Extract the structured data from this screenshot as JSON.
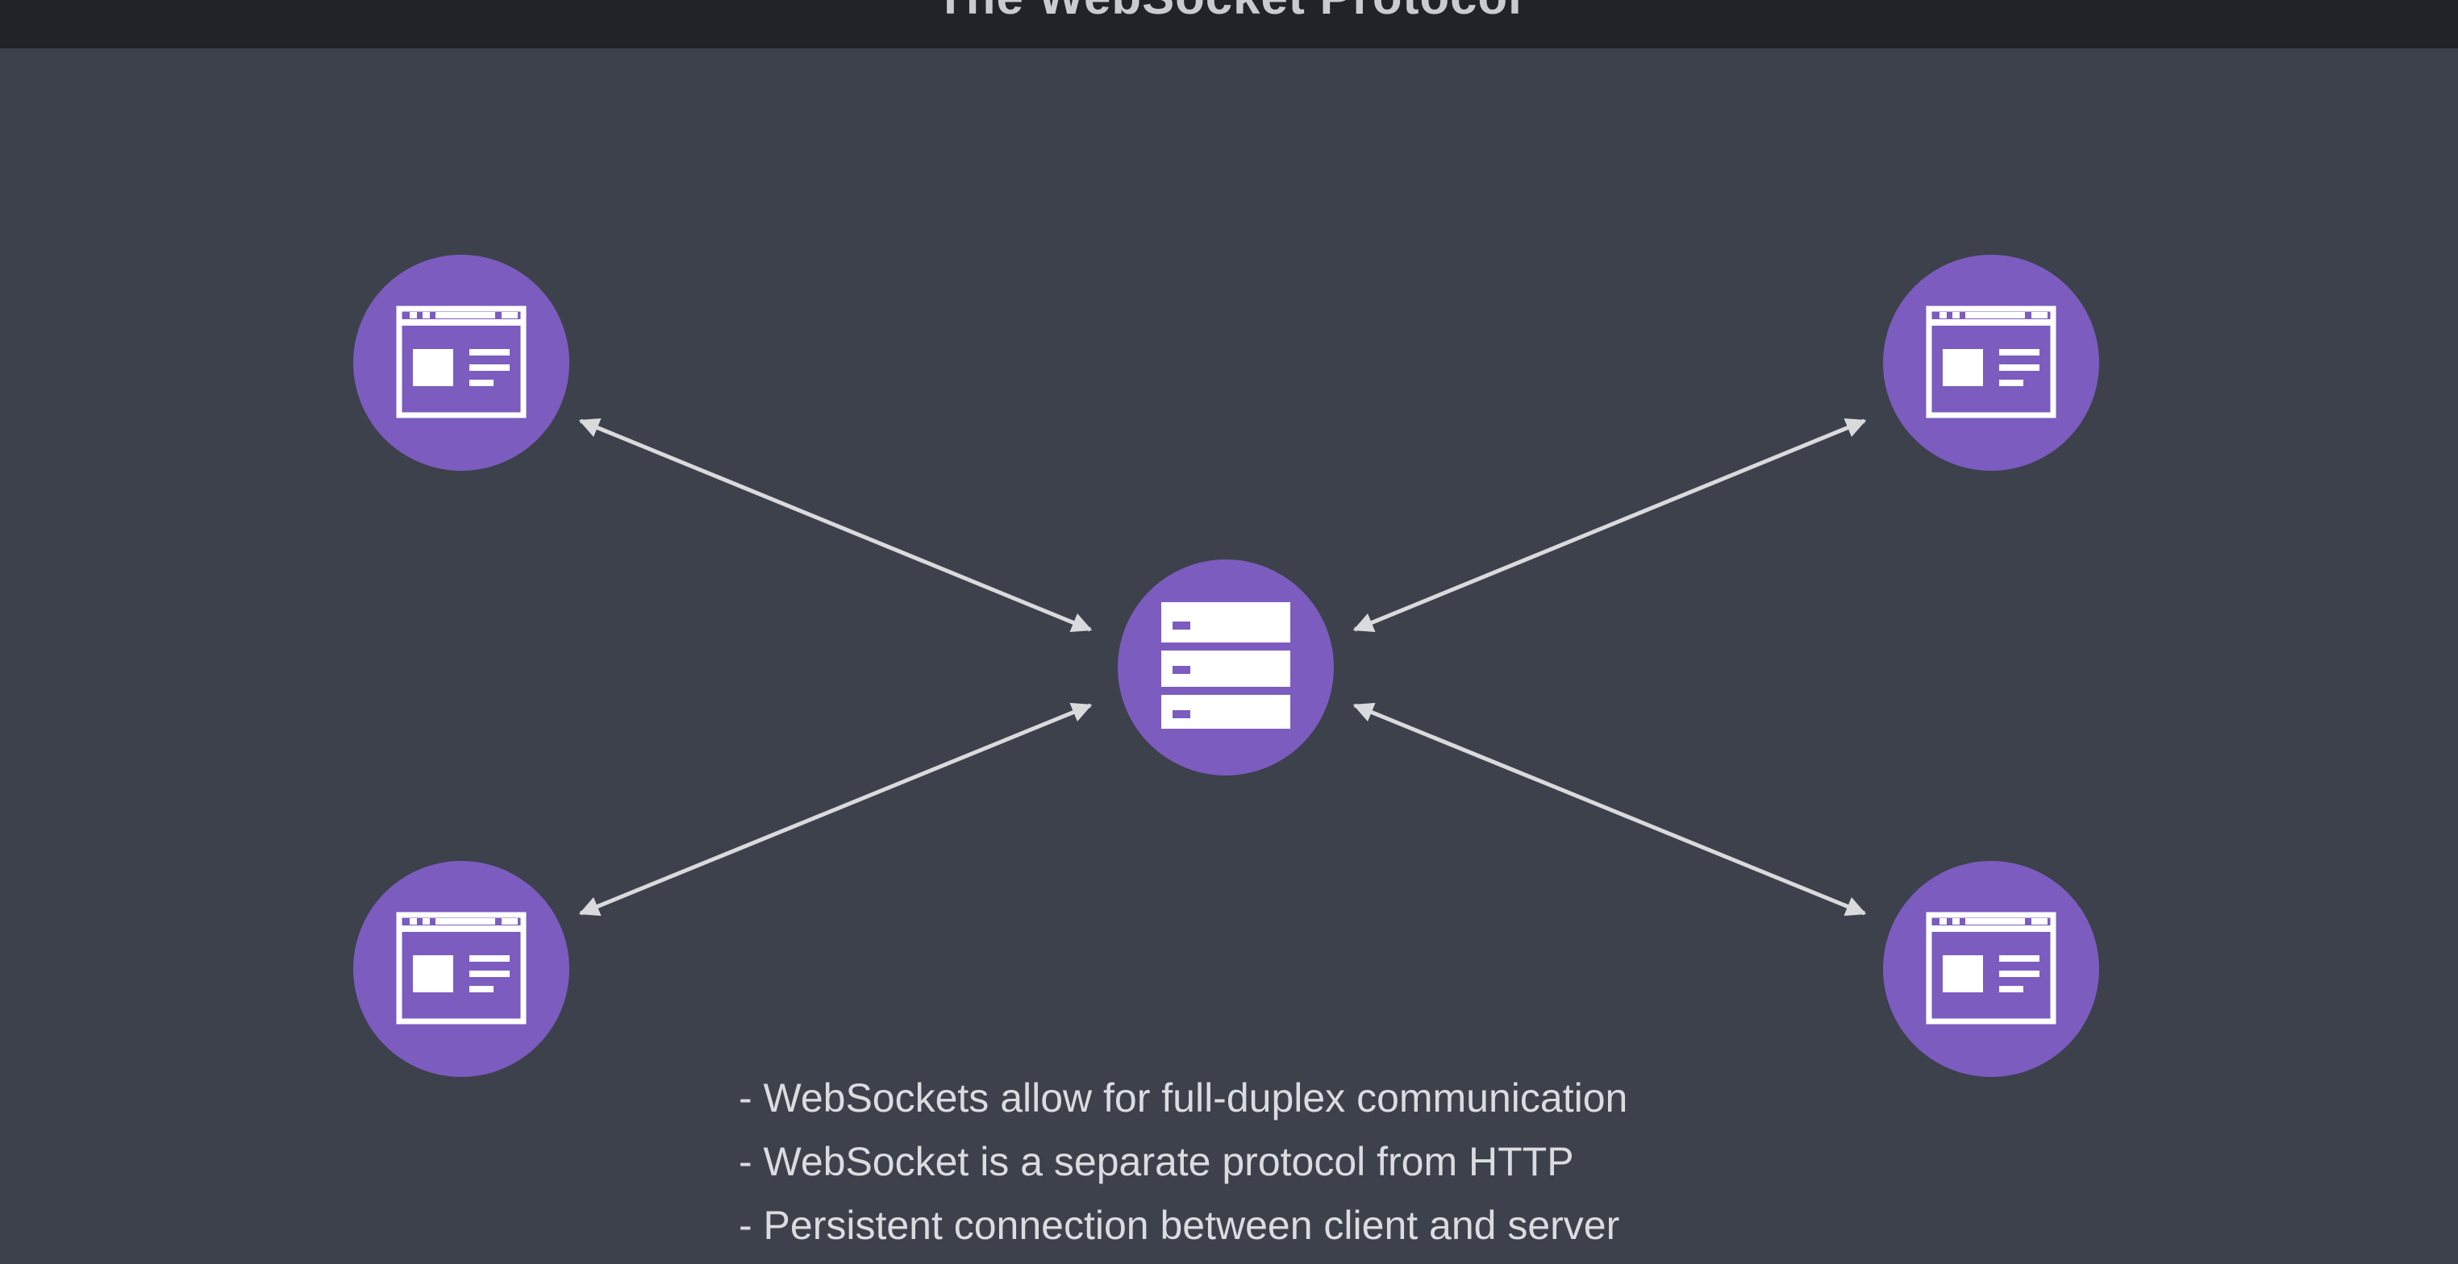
{
  "header": {
    "title": "The WebSocket Protocol"
  },
  "diagram": {
    "center_node": {
      "icon": "server-icon",
      "color": "#7c5cbf"
    },
    "client_nodes": [
      {
        "name": "client-top-left",
        "icon": "browser-window-icon"
      },
      {
        "name": "client-top-right",
        "icon": "browser-window-icon"
      },
      {
        "name": "client-bottom-left",
        "icon": "browser-window-icon"
      },
      {
        "name": "client-bottom-right",
        "icon": "browser-window-icon"
      }
    ],
    "connection_style": "bidirectional-arrow",
    "colors": {
      "node": "#7c5cbf",
      "arrow": "#d9dadd",
      "background": "#3c414b",
      "header": "#212328"
    }
  },
  "bullets": [
    "- WebSockets allow for full-duplex communication",
    "- WebSocket is a separate protocol from HTTP",
    "- Persistent connection between client and server"
  ]
}
